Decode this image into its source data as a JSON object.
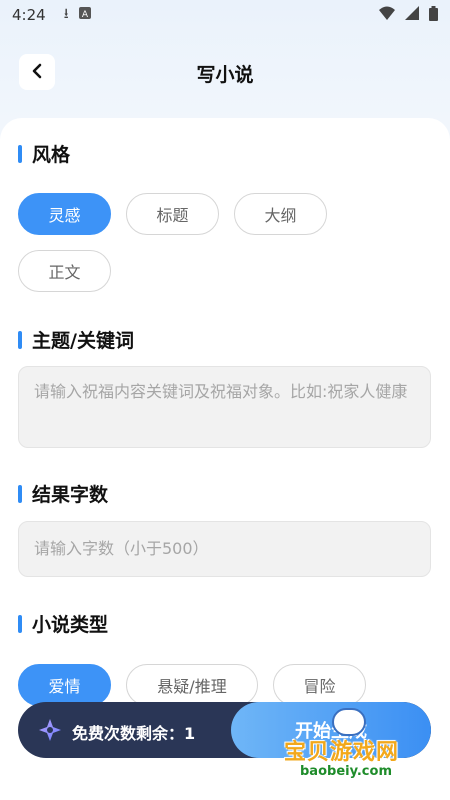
{
  "status_bar": {
    "time": "4:24",
    "icons_left": [
      "download-icon",
      "a-box-icon"
    ],
    "icons_right": [
      "wifi-icon",
      "signal-icon",
      "battery-icon"
    ]
  },
  "header": {
    "back_icon": "chevron-left-icon",
    "title": "写小说"
  },
  "sections": {
    "style": {
      "title": "风格",
      "chips": [
        "灵感",
        "标题",
        "大纲",
        "正文"
      ],
      "selected": "灵感"
    },
    "topic": {
      "title": "主题/关键词",
      "placeholder": "请输入祝福内容关键词及祝福对象。比如:祝家人健康"
    },
    "word_count": {
      "title": "结果字数",
      "placeholder": "请输入字数（小于500）"
    },
    "genre": {
      "title": "小说类型",
      "chips": [
        "爱情",
        "悬疑/推理",
        "冒险"
      ],
      "selected": "爱情"
    }
  },
  "bottom_bar": {
    "icon": "sparkle-icon",
    "free_label": "免费次数剩余：1",
    "start_label": "开始生成"
  },
  "watermark": {
    "text": "宝贝游戏网",
    "url": "baobeiy.com"
  },
  "colors": {
    "accent": "#3d93f7",
    "section_bar": "#2f8cf5",
    "bottom_bar_bg": "#2a3656"
  }
}
